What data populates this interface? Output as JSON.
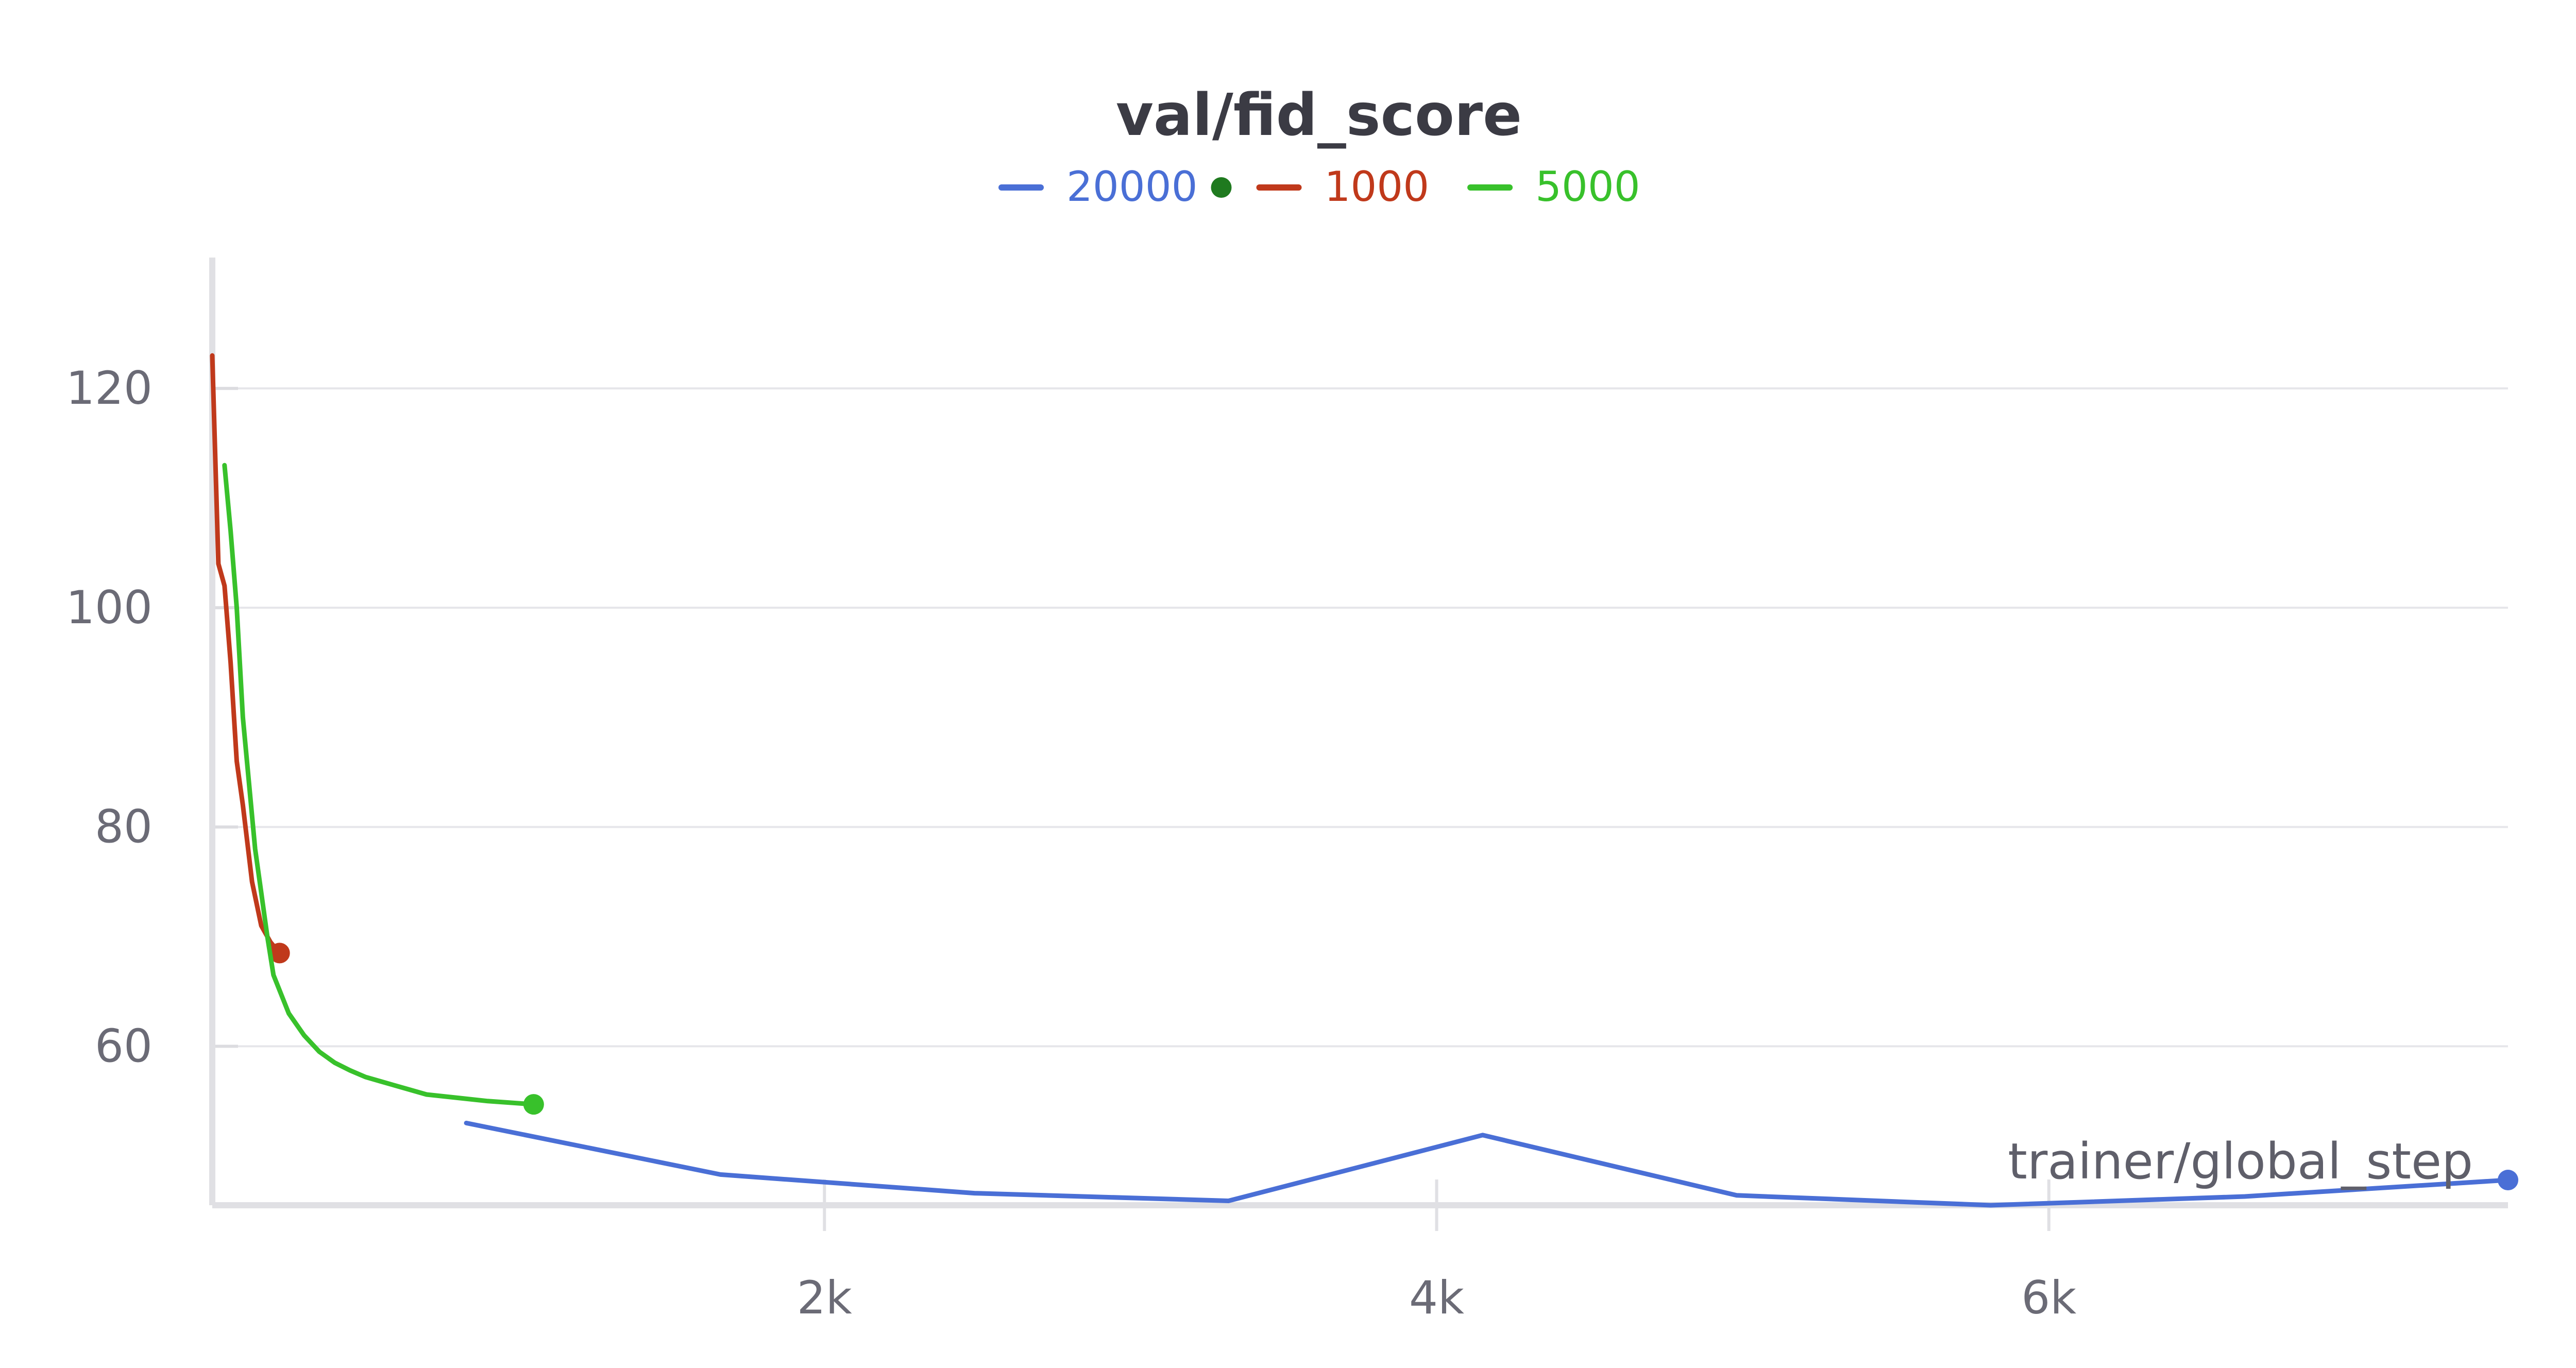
{
  "chart_data": {
    "type": "line",
    "title": "val/fid_score",
    "xlabel": "trainer/global_step",
    "ylabel": "",
    "xlim": [
      0,
      7500
    ],
    "ylim": [
      45.5,
      131
    ],
    "x_ticks": [
      {
        "value": 2000,
        "label": "2k"
      },
      {
        "value": 4000,
        "label": "4k"
      },
      {
        "value": 6000,
        "label": "6k"
      }
    ],
    "y_ticks": [
      {
        "value": 60,
        "label": "60"
      },
      {
        "value": 80,
        "label": "80"
      },
      {
        "value": 100,
        "label": "100"
      },
      {
        "value": 120,
        "label": "120"
      }
    ],
    "grid": true,
    "legend_position": "top-center",
    "series": [
      {
        "name": "20000",
        "color": "#4a6fd6",
        "x": [
          830,
          1660,
          2490,
          3320,
          4150,
          4980,
          5810,
          6640,
          7500
        ],
        "y": [
          53,
          48.3,
          46.6,
          45.9,
          51.9,
          46.4,
          45.5,
          46.3,
          47.8
        ],
        "end_marker": true
      },
      {
        "name": "1000",
        "color": "#c0391b",
        "x": [
          0,
          20,
          40,
          60,
          80,
          100,
          130,
          160,
          190,
          220
        ],
        "y": [
          123,
          104,
          102,
          95,
          86,
          82,
          75,
          71,
          69.5,
          68.5
        ],
        "end_marker": true
      },
      {
        "name": "5000",
        "color": "#38c12b",
        "x": [
          40,
          60,
          80,
          100,
          120,
          140,
          160,
          180,
          200,
          250,
          300,
          350,
          400,
          450,
          500,
          550,
          650,
          700,
          800,
          900,
          1000,
          1050
        ],
        "y": [
          113,
          107,
          100,
          90,
          84,
          78,
          74,
          70,
          66.5,
          63,
          61,
          59.5,
          58.5,
          57.8,
          57.2,
          56.8,
          56,
          55.6,
          55.3,
          55,
          54.8,
          54.7
        ],
        "end_marker": true
      }
    ],
    "legend_extra_dot_color": "#1f7a1f"
  }
}
